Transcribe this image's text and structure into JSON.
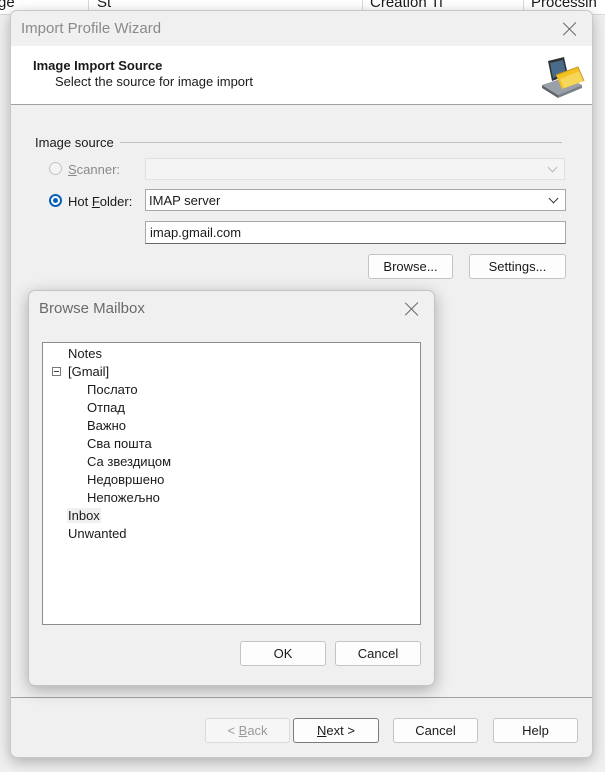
{
  "background": {
    "columns": [
      "ge",
      "St",
      "Creation Ti",
      "Processin"
    ]
  },
  "wizard": {
    "title": "Import Profile Wizard",
    "header_title": "Image Import Source",
    "header_subtitle": "Select the source for image import",
    "header_icon": "scanner-folder-icon",
    "group_label": "Image source",
    "scanner": {
      "label_accel": "S",
      "label_rest": "canner:",
      "selected": false,
      "enabled": false,
      "value": ""
    },
    "hot_folder": {
      "label_pre": "Hot ",
      "label_accel": "F",
      "label_rest": "older:",
      "selected": true,
      "source_type": "IMAP server",
      "server": "imap.gmail.com"
    },
    "browse_button": "Browse...",
    "settings_button": "Settings...",
    "back_button": {
      "arrow": "< ",
      "accel": "B",
      "rest": "ack"
    },
    "next_button": {
      "accel": "N",
      "rest": "ext >"
    },
    "cancel_button": "Cancel",
    "help_button": "Help"
  },
  "browse_dialog": {
    "title": "Browse Mailbox",
    "tree": [
      {
        "label": "Notes",
        "level": 0
      },
      {
        "label": "[Gmail]",
        "level": 0,
        "expanded": true
      },
      {
        "label": "Послато",
        "level": 1
      },
      {
        "label": "Отпад",
        "level": 1
      },
      {
        "label": "Важно",
        "level": 1
      },
      {
        "label": "Сва пошта",
        "level": 1
      },
      {
        "label": "Са звездицом",
        "level": 1
      },
      {
        "label": "Недовршено",
        "level": 1
      },
      {
        "label": "Непожељно",
        "level": 1
      },
      {
        "label": "Inbox",
        "level": 0,
        "selected": true
      },
      {
        "label": "Unwanted",
        "level": 0
      }
    ],
    "ok_button": "OK",
    "cancel_button": "Cancel"
  },
  "colors": {
    "accent": "#0a5fb8",
    "folder_yellow": "#f3c320"
  }
}
